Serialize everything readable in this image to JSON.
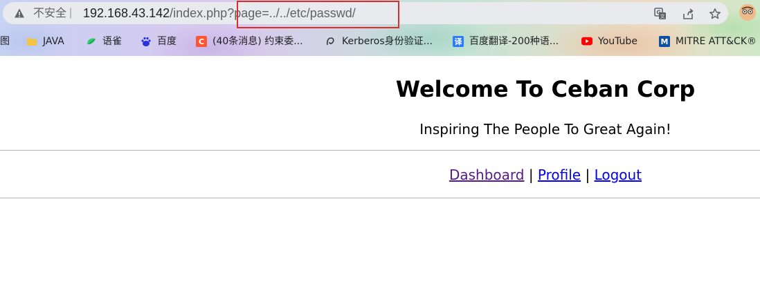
{
  "browser": {
    "insecure_label": "不安全",
    "separator": "|",
    "url_host": "192.168.43.142",
    "url_path": "/index.php?",
    "url_query": "page=../../etc/passwd/",
    "bookmarks": [
      {
        "label": "图",
        "icon": "folder-icon"
      },
      {
        "label": "JAVA",
        "icon": "folder-icon"
      },
      {
        "label": "语雀",
        "icon": "yuque-icon"
      },
      {
        "label": "百度",
        "icon": "baidu-icon"
      },
      {
        "label": "(40条消息) 约束委...",
        "icon": "csdn-icon"
      },
      {
        "label": "Kerberos身份验证...",
        "icon": "kerberos-icon"
      },
      {
        "label": "百度翻译-200种语...",
        "icon": "baidu-translate-icon"
      },
      {
        "label": "YouTube",
        "icon": "youtube-icon"
      },
      {
        "label": "MITRE ATT&CK®",
        "icon": "mitre-icon"
      }
    ],
    "colors": {
      "highlight_box": "#e02b2b"
    }
  },
  "page": {
    "title": "Welcome To Ceban Corp",
    "subtitle": "Inspiring The People To Great Again!",
    "nav": {
      "dashboard": "Dashboard",
      "profile": "Profile",
      "logout": "Logout",
      "separator": "|"
    },
    "colors": {
      "link": "#0000ee",
      "visited_link": "#551a8b"
    }
  }
}
